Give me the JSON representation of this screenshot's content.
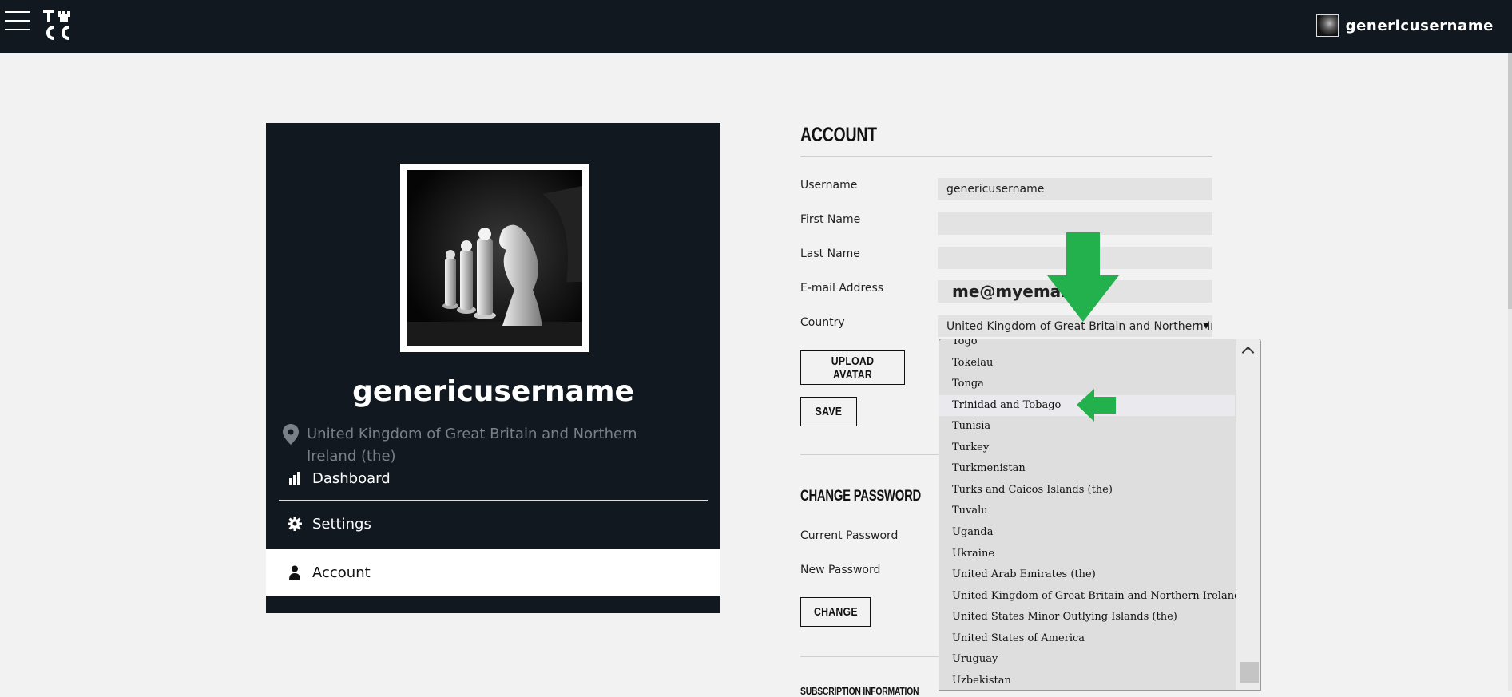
{
  "header": {
    "logo_text": "TICC",
    "username": "genericusername"
  },
  "profile": {
    "name": "genericusername",
    "location": "United Kingdom of Great Britain and Northern Ireland (the)",
    "nav": [
      {
        "label": "Dashboard",
        "icon": "bar-chart-icon"
      },
      {
        "label": "Settings",
        "icon": "gear-icon"
      },
      {
        "label": "Account",
        "icon": "user-icon",
        "active": true
      }
    ]
  },
  "account": {
    "title": "ACCOUNT",
    "fields": {
      "username_label": "Username",
      "username_value": "genericusername",
      "first_name_label": "First Name",
      "first_name_value": "",
      "last_name_label": "Last Name",
      "last_name_value": "",
      "email_label": "E-mail Address",
      "email_value": "me@myemail.c",
      "country_label": "Country",
      "country_value": "United Kingdom of Great Britain and Northern Ireland (the)"
    },
    "upload_avatar_label": "UPLOAD AVATAR",
    "save_label": "SAVE"
  },
  "change_password": {
    "title": "CHANGE PASSWORD",
    "current_label": "Current Password",
    "new_label": "New Password",
    "change_label": "CHANGE"
  },
  "subscription": {
    "title": "SUBSCRIPTION INFORMATION"
  },
  "country_dropdown": {
    "partial_top": "Togo",
    "options": [
      "Tokelau",
      "Tonga",
      "Trinidad and Tobago",
      "Tunisia",
      "Turkey",
      "Turkmenistan",
      "Turks and Caicos Islands (the)",
      "Tuvalu",
      "Uganda",
      "Ukraine",
      "United Arab Emirates (the)",
      "United Kingdom of Great Britain and Northern Ireland (the)",
      "United States Minor Outlying Islands (the)",
      "United States of America",
      "Uruguay",
      "Uzbekistan"
    ],
    "highlighted": "Trinidad and Tobago"
  },
  "colors": {
    "dark_bg": "#111820",
    "page_bg": "#f2f2f2",
    "annotation_arrow": "#22b14c"
  }
}
